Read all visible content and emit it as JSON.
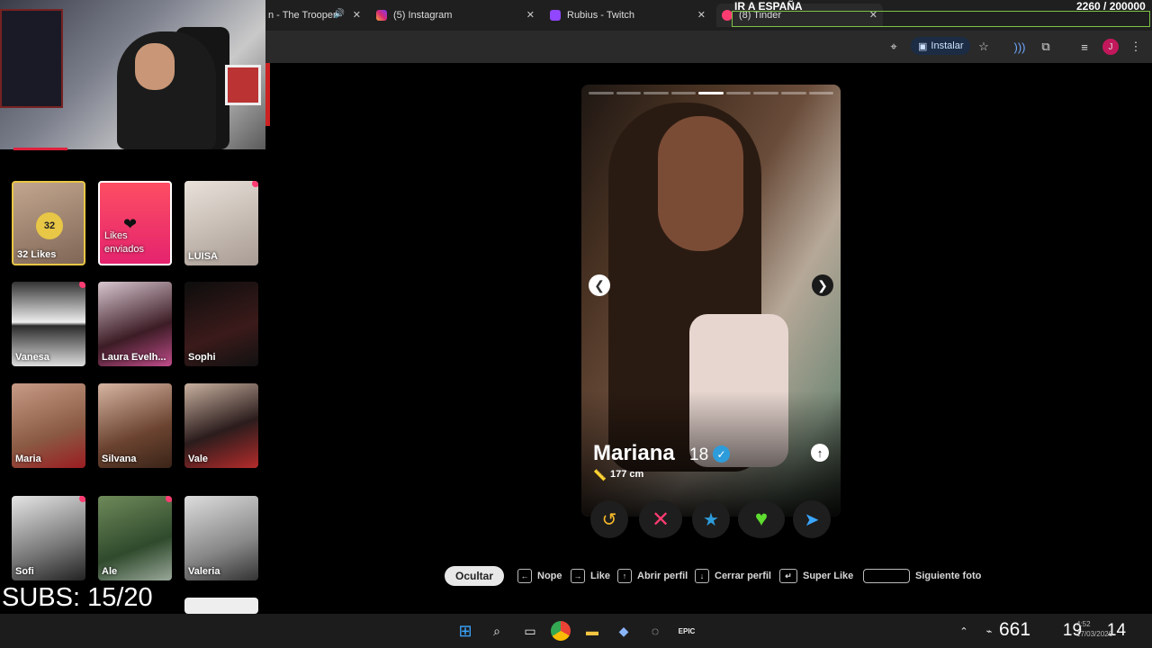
{
  "browser": {
    "tabs": [
      {
        "label": "n - The Trooper"
      },
      {
        "label": "(5) Instagram"
      },
      {
        "label": "Rubius - Twitch"
      },
      {
        "label": "(8) Tinder"
      }
    ],
    "install_label": "Instalar",
    "profile_initial": "J"
  },
  "overlay": {
    "goal_title": "IR A ESPAÑA",
    "goal_counter": "2260 / 200000",
    "subs": "SUBS: 15/20"
  },
  "matches": {
    "likes_count": "32",
    "likes_label": "32 Likes",
    "sent_label": "Likes enviados",
    "people": [
      {
        "name": "LUISA",
        "new": true
      },
      {
        "name": "Vanesa",
        "new": true
      },
      {
        "name": "Laura Evelh...",
        "new": false
      },
      {
        "name": "Sophi",
        "new": false
      },
      {
        "name": "Maria",
        "new": false
      },
      {
        "name": "Silvana",
        "new": false
      },
      {
        "name": "Vale",
        "new": false
      },
      {
        "name": "Sofi",
        "new": true
      },
      {
        "name": "Ale",
        "new": true
      },
      {
        "name": "Valeria",
        "new": false
      }
    ]
  },
  "profile": {
    "name": "Mariana",
    "age": "18",
    "height": "177 cm",
    "photo_count": 9,
    "active_photo": 5
  },
  "shortcuts": {
    "hide": "Ocultar",
    "nope": "Nope",
    "like": "Like",
    "open": "Abrir perfil",
    "close": "Cerrar perfil",
    "superlike": "Super Like",
    "next_photo": "Siguiente foto"
  },
  "taskbar": {
    "clock_big": "661",
    "clock_h": "19",
    "clock_s": "14",
    "time": "4:52",
    "date": "17/03/2026"
  },
  "colors": {
    "tinder_pink": "#fe3c72",
    "gold": "#e8c646",
    "goal_green": "#7ec247"
  }
}
